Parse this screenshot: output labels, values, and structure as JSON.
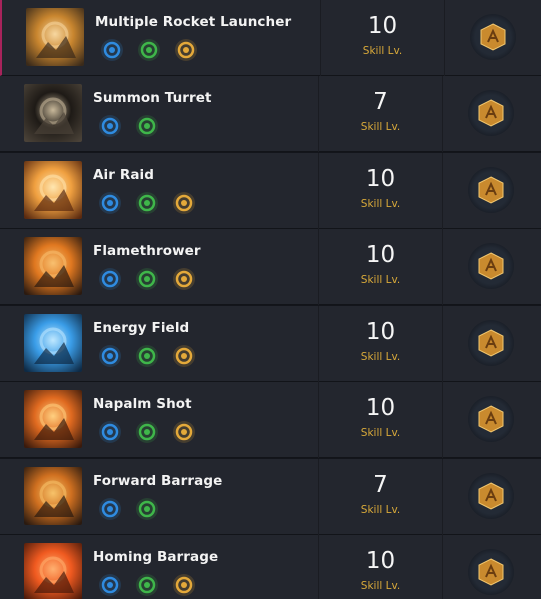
{
  "level_label": "Skill Lv.",
  "colors": {
    "row_bg": "#23262e",
    "level_label": "#d8a93a",
    "selected_accent": "#a8235b",
    "tripod_blue": "#2f8be0",
    "tripod_green": "#3fb64a",
    "tripod_gold": "#e4a93a",
    "rune_gold": "#c98a2e"
  },
  "skills": [
    {
      "name": "Multiple Rocket Launcher",
      "level": "10",
      "icon": "rocket-launcher-skill-icon",
      "tripods": [
        "blue-flame-tripod-icon",
        "green-gear-tripod-icon",
        "gold-burst-tripod-icon"
      ],
      "rune": "gold-rune-icon",
      "selected": true
    },
    {
      "name": "Summon Turret",
      "level": "7",
      "icon": "turret-skill-icon",
      "tripods": [
        "blue-mech-tripod-icon",
        "green-claw-tripod-icon"
      ],
      "rune": "gold-rune-icon"
    },
    {
      "name": "Air Raid",
      "level": "10",
      "icon": "air-raid-skill-icon",
      "tripods": [
        "blue-dash-tripod-icon",
        "green-slash-tripod-icon",
        "gold-sun-tripod-icon"
      ],
      "rune": "gold-rune-icon"
    },
    {
      "name": "Flamethrower",
      "level": "10",
      "icon": "flamethrower-skill-icon",
      "tripods": [
        "blue-arrow-tripod-icon",
        "green-figure-tripod-icon",
        "gold-pillar-tripod-icon"
      ],
      "rune": "gold-rune-icon"
    },
    {
      "name": "Energy Field",
      "level": "10",
      "icon": "energy-field-skill-icon",
      "tripods": [
        "blue-arrow-tripod-icon",
        "green-timer-tripod-icon",
        "gold-pillar-tripod-icon"
      ],
      "rune": "gold-rune-icon"
    },
    {
      "name": "Napalm Shot",
      "level": "10",
      "icon": "napalm-shot-skill-icon",
      "tripods": [
        "blue-target-tripod-icon",
        "green-figure-tripod-icon",
        "gold-burst-tripod-icon"
      ],
      "rune": "gold-rune-icon"
    },
    {
      "name": "Forward Barrage",
      "level": "7",
      "icon": "forward-barrage-skill-icon",
      "tripods": [
        "blue-orb-tripod-icon",
        "green-claw-tripod-icon"
      ],
      "rune": "gold-rune-icon"
    },
    {
      "name": "Homing Barrage",
      "level": "10",
      "icon": "homing-barrage-skill-icon",
      "tripods": [
        "blue-fountain-tripod-icon",
        "green-slash-tripod-icon",
        "gold-sun-tripod-icon"
      ],
      "rune": "gold-rune-icon"
    }
  ]
}
